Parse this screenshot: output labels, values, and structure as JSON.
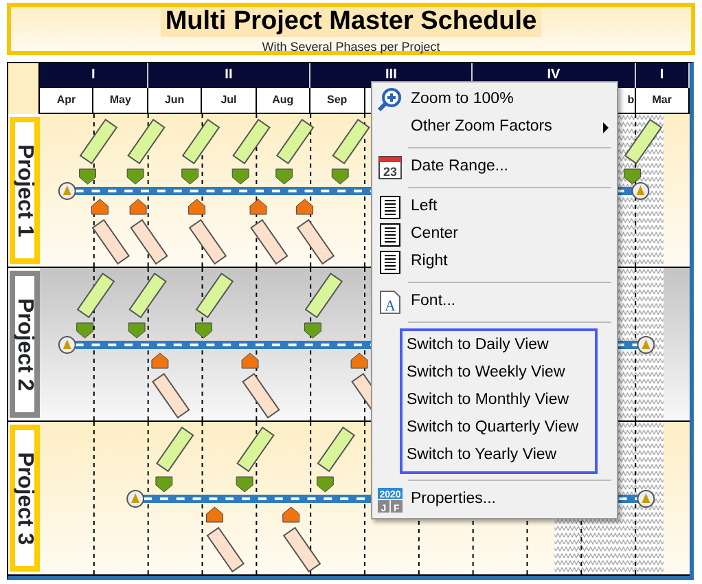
{
  "title": "Multi Project Master Schedule",
  "subtitle": "With Several Phases per Project",
  "quarters": [
    "I",
    "II",
    "III",
    "IV",
    "I"
  ],
  "months": [
    "Apr",
    "May",
    "Jun",
    "Jul",
    "Aug",
    "Sep"
  ],
  "months_after_menu": [
    "b",
    "Mar"
  ],
  "projects": [
    {
      "label": "Project 1",
      "color": "#ffcc00"
    },
    {
      "label": "Project 2",
      "color": "#888888"
    },
    {
      "label": "Project 3",
      "color": "#ffcc00"
    }
  ],
  "context_menu": {
    "sections": [
      {
        "framed": false,
        "items": [
          {
            "label": "Zoom to 100%",
            "kind": "zoom",
            "submenu": false
          },
          {
            "label": "Other Zoom Factors",
            "kind": "plain",
            "submenu": true
          }
        ]
      },
      {
        "framed": false,
        "items": [
          {
            "label": "Date Range...",
            "kind": "calendar",
            "icon_text": [
              "23"
            ],
            "submenu": false
          }
        ]
      },
      {
        "framed": false,
        "items": [
          {
            "label": "Left",
            "kind": "align",
            "submenu": false
          },
          {
            "label": "Center",
            "kind": "align",
            "submenu": false
          },
          {
            "label": "Right",
            "kind": "align",
            "submenu": false
          }
        ]
      },
      {
        "framed": false,
        "items": [
          {
            "label": "Font...",
            "kind": "font",
            "icon_text": [
              "A"
            ],
            "submenu": false
          }
        ]
      },
      {
        "framed": true,
        "items": [
          {
            "label": "Switch to Daily View",
            "submenu": false
          },
          {
            "label": "Switch to Weekly View",
            "submenu": false
          },
          {
            "label": "Switch to Monthly View",
            "submenu": false
          },
          {
            "label": "Switch to Quarterly View",
            "submenu": false
          },
          {
            "label": "Switch to Yearly View",
            "submenu": false
          }
        ]
      },
      {
        "framed": false,
        "items": [
          {
            "label": "Properties...",
            "kind": "properties",
            "icon_text": [
              "2020",
              "J",
              "F"
            ],
            "submenu": false
          }
        ]
      }
    ]
  }
}
